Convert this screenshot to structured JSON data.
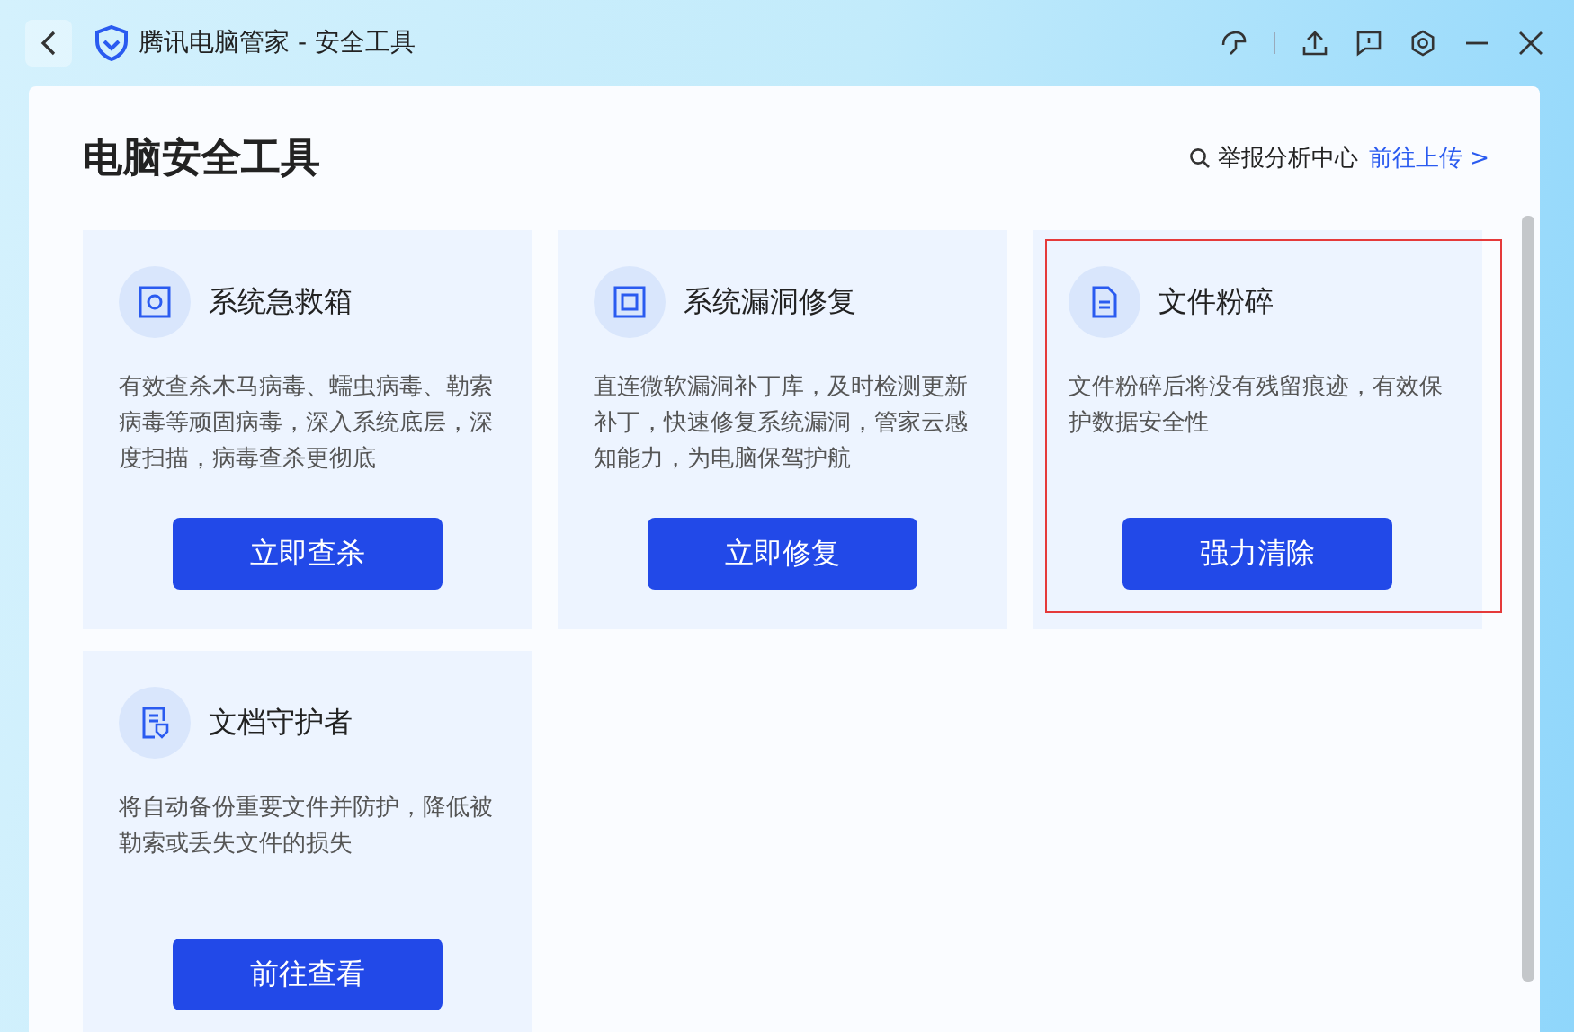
{
  "window": {
    "title": "腾讯电脑管家 - 安全工具"
  },
  "page": {
    "heading": "电脑安全工具",
    "report_link_label": "举报分析中心",
    "report_link_action": "前往上传 >"
  },
  "cards": [
    {
      "title": "系统急救箱",
      "description": "有效查杀木马病毒、蠕虫病毒、勒索病毒等顽固病毒，深入系统底层，深度扫描，病毒查杀更彻底",
      "button": "立即查杀",
      "highlighted": false
    },
    {
      "title": "系统漏洞修复",
      "description": "直连微软漏洞补丁库，及时检测更新补丁，快速修复系统漏洞，管家云感知能力，为电脑保驾护航",
      "button": "立即修复",
      "highlighted": false
    },
    {
      "title": "文件粉碎",
      "description": "文件粉碎后将没有残留痕迹，有效保护数据安全性",
      "button": "强力清除",
      "highlighted": true
    },
    {
      "title": "文档守护者",
      "description": "将自动备份重要文件并防护，降低被勒索或丢失文件的损失",
      "button": "前往查看",
      "highlighted": false
    }
  ]
}
